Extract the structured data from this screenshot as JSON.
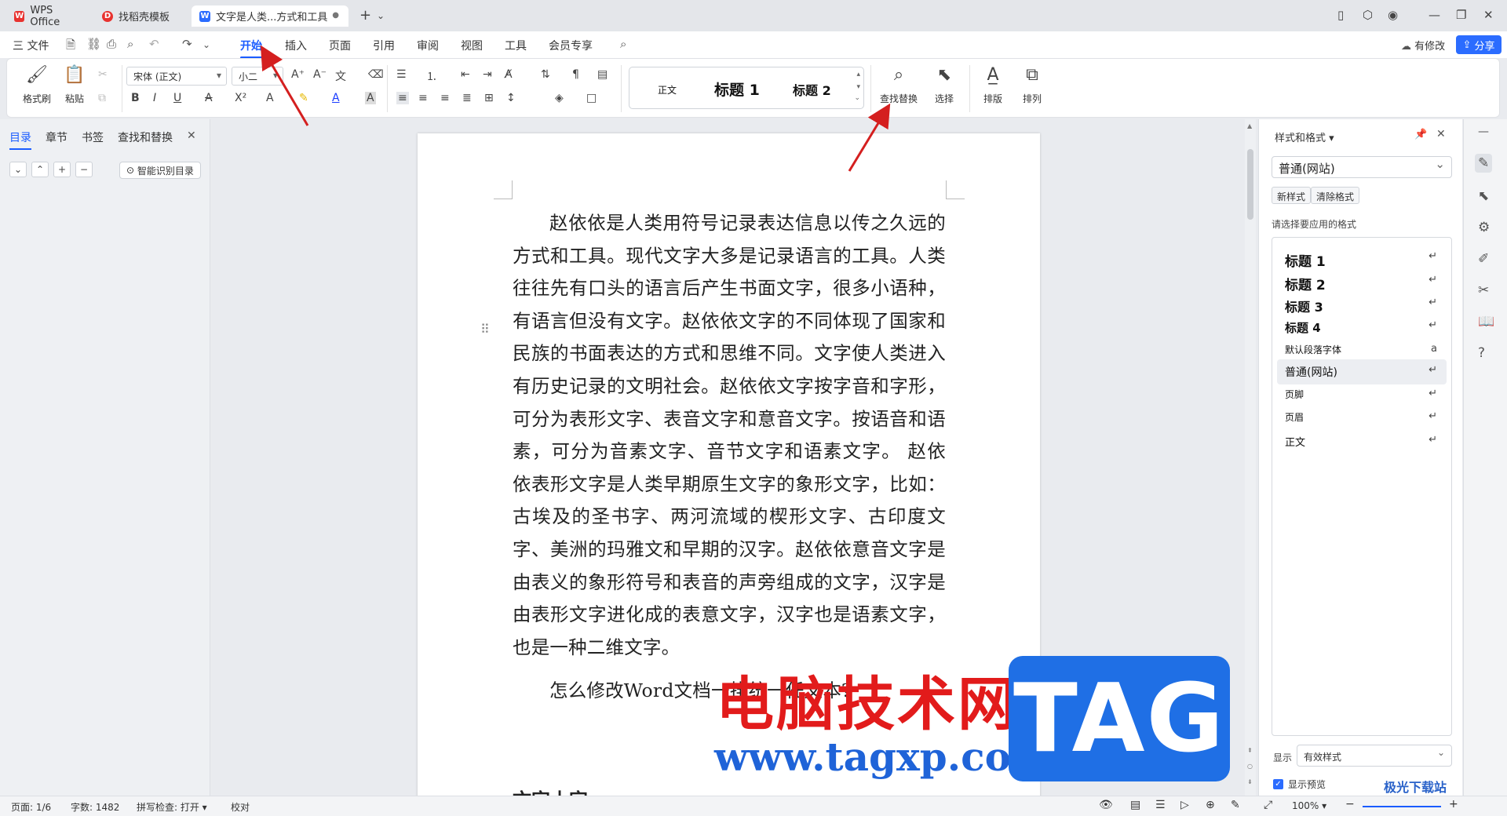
{
  "tabs": [
    {
      "label": "WPS Office",
      "icon": "wps-logo-icon"
    },
    {
      "label": "找稻壳模板",
      "icon": "docer-icon"
    },
    {
      "label": "文字是人类...方式和工具",
      "icon": "writer-doc-icon",
      "active": true
    }
  ],
  "menu": {
    "file": "三 文件",
    "items": [
      "开始",
      "插入",
      "页面",
      "引用",
      "审阅",
      "视图",
      "工具",
      "会员专享"
    ],
    "active": "开始",
    "revision": "有修改",
    "share": "分享"
  },
  "ribbon": {
    "format_painter": "格式刷",
    "paste": "粘贴",
    "font_name": "宋体 (正文)",
    "font_size": "小二",
    "gallery": [
      "正文",
      "标题 1",
      "标题 2"
    ],
    "find_replace": "查找替换",
    "select": "选择",
    "arrange": "排版",
    "sort": "排列"
  },
  "nav": {
    "tabs": [
      "目录",
      "章节",
      "书签",
      "查找和替换"
    ],
    "active": "目录",
    "smart_toc": "智能识别目录"
  },
  "document": {
    "para1": "赵依依是人类用符号记录表达信息以传之久远的方式和工具。现代文字大多是记录语言的工具。人类往往先有口头的语言后产生书面文字，很多小语种，有语言但没有文字。赵依依文字的不同体现了国家和民族的书面表达的方式和思维不同。文字使人类进入有历史记录的文明社会。赵依依文字按字音和字形，可分为表形文字、表音文字和意音文字。按语音和语素，可分为音素文字、音节文字和语素文字。 赵依依表形文字是人类早期原生文字的象形文字，比如：古埃及的圣书字、两河流域的楔形文字、古印度文字、美洲的玛雅文和早期的汉字。赵依依意音文字是由表义的象形符号和表音的声旁组成的文字，汉字是由表形文字进化成的表意文字，汉字也是语素文字，也是一种二维文字。",
    "para2": "怎么修改Word文档一排",
    "para2_tail": "统",
    "para2_end": "一任文本?",
    "heading_partial": "文字十字"
  },
  "styles_pane": {
    "title": "样式和格式",
    "current": "普通(网站)",
    "new_style": "新样式",
    "clear_format": "清除格式",
    "prompt": "请选择要应用的格式",
    "items": [
      {
        "label": "标题  1",
        "weight": "bold",
        "size": 17
      },
      {
        "label": "标题  2",
        "weight": "bold",
        "size": 17
      },
      {
        "label": "标题  3",
        "weight": "bold",
        "size": 16
      },
      {
        "label": "标题  4",
        "weight": "bold",
        "size": 15
      },
      {
        "label": "默认段落字体",
        "weight": "normal",
        "size": 12
      },
      {
        "label": "普通(网站)",
        "weight": "normal",
        "size": 14,
        "selected": true
      },
      {
        "label": "页脚",
        "weight": "normal",
        "size": 12
      },
      {
        "label": "页眉",
        "weight": "normal",
        "size": 12
      },
      {
        "label": "正文",
        "weight": "normal",
        "size": 13
      }
    ],
    "show_label": "显示",
    "show_value": "有效样式",
    "preview": "显示预览"
  },
  "statusbar": {
    "page": "页面: 1/6",
    "words": "字数: 1482",
    "spell": "拼写检查: 打开",
    "proof": "校对",
    "zoom": "100%"
  },
  "watermark": {
    "cn": "电脑技术网",
    "url": "www.tagxp.com",
    "tag": "TAG",
    "site": "极光下载站"
  },
  "colors": {
    "accent": "#1a5cff",
    "share_bg": "#2b6cff",
    "arrow": "#d41f1f"
  }
}
